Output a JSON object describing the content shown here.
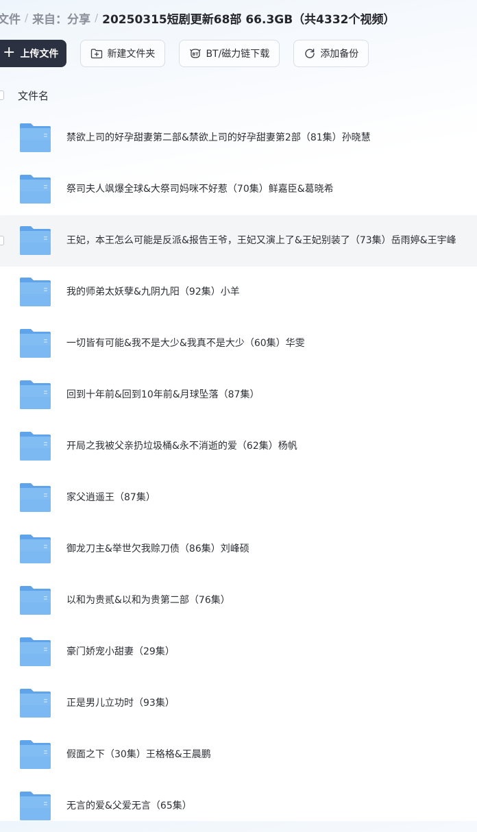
{
  "breadcrumb": {
    "items": [
      "文件",
      "来自：分享"
    ],
    "current": "20250315短剧更新68部 66.3GB（共4332个视频）"
  },
  "toolbar": {
    "upload_label": "上传文件",
    "new_folder_label": "新建文件夹",
    "bt_label": "BT/磁力链下载",
    "backup_label": "添加备份"
  },
  "list": {
    "header_label": "文件名",
    "items": [
      {
        "name": "禁欲上司的好孕甜妻第二部&禁欲上司的好孕甜妻第2部（81集）孙晓慧"
      },
      {
        "name": "祭司夫人飒爆全球&大祭司妈咪不好惹（70集）鲜嘉臣&葛晓希"
      },
      {
        "name": "王妃，本王怎么可能是反派&报告王爷，王妃又演上了&王妃别装了（73集）岳雨婷&王宇峰"
      },
      {
        "name": "我的师弟太妖孽&九阴九阳（92集）小羊"
      },
      {
        "name": "一切皆有可能&我不是大少&我真不是大少（60集）华雯"
      },
      {
        "name": "回到十年前&回到10年前&月球坠落（87集）"
      },
      {
        "name": "开局之我被父亲扔垃圾桶&永不消逝的爱（62集）杨帆"
      },
      {
        "name": "家父逍遥王（87集）"
      },
      {
        "name": "御龙刀主&举世欠我赊刀债（86集）刘峰硕"
      },
      {
        "name": "以和为贵贰&以和为贵第二部（76集）"
      },
      {
        "name": "豪门娇宠小甜妻（29集）"
      },
      {
        "name": "正是男儿立功时（93集）"
      },
      {
        "name": "假面之下（30集）王格格&王晨鹏"
      },
      {
        "name": "无言的爱&父爱无言（65集）"
      }
    ]
  },
  "colors": {
    "primary_button": "#2c3141",
    "folder_main": "#7cb9f2",
    "folder_tab": "#5fa4ea",
    "hover_row": "#f4f5f7"
  }
}
